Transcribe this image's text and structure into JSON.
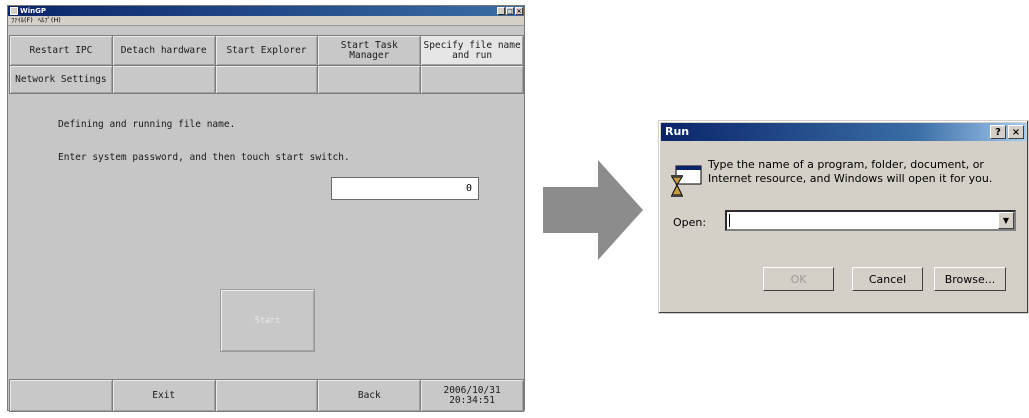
{
  "wingp": {
    "title": "WinGP",
    "window_buttons": [
      "_",
      "□",
      "×"
    ],
    "menu": [
      "ﾌｧｲﾙ(F)",
      "ﾍﾙﾌﾟ(H)"
    ],
    "row1": [
      "Restart IPC",
      "Detach hardware",
      "Start Explorer",
      "Start Task Manager",
      "Specify file name and run"
    ],
    "row2": [
      "Network Settings",
      "",
      "",
      "",
      ""
    ],
    "message1": "Defining and running file name.",
    "message2": "Enter system password, and then touch start switch.",
    "password_value": "0",
    "start_label": "Start",
    "bottom": [
      "",
      "Exit",
      "",
      "Back",
      "2006/10/31\n20:34:51"
    ]
  },
  "run_dialog": {
    "title": "Run",
    "help_btn": "?",
    "close_btn": "×",
    "description": "Type the name of a program, folder, document, or Internet resource, and Windows will open it for you.",
    "open_label": "Open:",
    "open_value": "",
    "ok": "OK",
    "cancel": "Cancel",
    "browse": "Browse..."
  },
  "colors": {
    "arrow": "#8c8c8c",
    "titlebar": "#0a246a"
  },
  "icons": [
    "windows-run-icon",
    "right-arrow-icon"
  ]
}
